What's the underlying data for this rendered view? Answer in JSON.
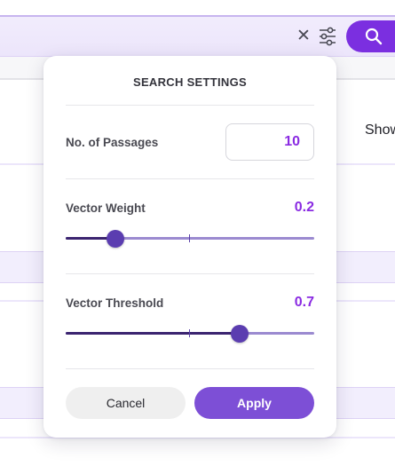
{
  "search_bar": {
    "clear_icon": "close-icon",
    "filter_icon": "sliders-icon",
    "search_icon": "magnifier-icon"
  },
  "background": {
    "show_label": "Show"
  },
  "settings": {
    "title": "SEARCH SETTINGS",
    "passages": {
      "label": "No. of Passages",
      "value": "10"
    },
    "vector_weight": {
      "label": "Vector Weight",
      "value": "0.2",
      "fraction": 0.2
    },
    "vector_threshold": {
      "label": "Vector Threshold",
      "value": "0.7",
      "fraction": 0.7
    },
    "cancel_label": "Cancel",
    "apply_label": "Apply"
  },
  "colors": {
    "accent": "#8a2be2",
    "search_button": "#7b2fe0",
    "apply_button": "#7d4fd6",
    "slider_fill": "#3b2470",
    "slider_rest": "#9b8ad0",
    "slider_thumb": "#5b3db0"
  }
}
